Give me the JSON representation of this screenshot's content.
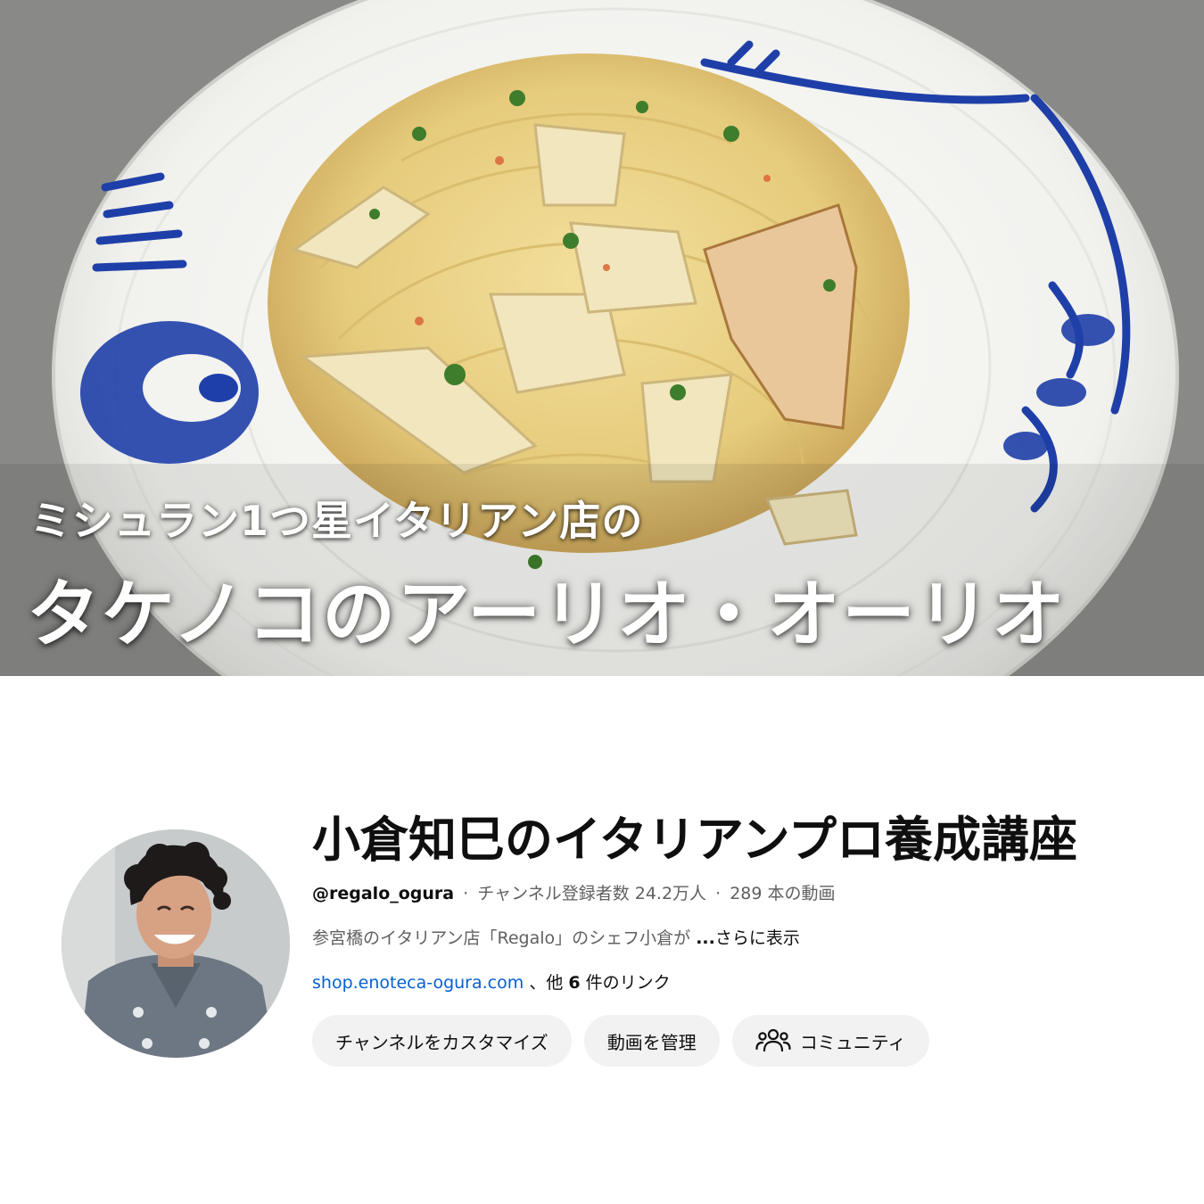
{
  "banner": {
    "caption_line1": "ミシュラン1つ星イタリアン店の",
    "caption_line2": "タケノコのアーリオ・オーリオ"
  },
  "channel": {
    "name": "小倉知巳のイタリアンプロ養成講座",
    "handle": "@regalo_ogura",
    "separator": "‧",
    "subscribers": "チャンネル登録者数 24.2万人",
    "video_count": "289 本の動画",
    "description": "参宮橋のイタリアン店「Regalo」のシェフ小倉が",
    "more_dots": "...",
    "more_label": "さらに表示",
    "link_url": "shop.enoteca-ogura.com",
    "link_suffix_pre": "、他",
    "link_count": "6",
    "link_suffix_post": "件のリンク"
  },
  "buttons": {
    "customize": "チャンネルをカスタマイズ",
    "manage_videos": "動画を管理",
    "community": "コミュニティ"
  },
  "icons": {
    "community": "people-icon"
  },
  "colors": {
    "link": "#065fd4",
    "button_bg": "#f2f2f2",
    "text_primary": "#0f0f0f",
    "text_secondary": "#606060"
  }
}
